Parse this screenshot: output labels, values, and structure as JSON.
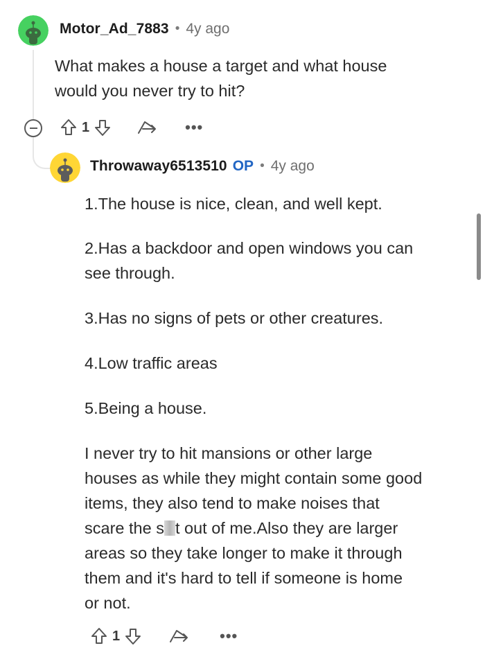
{
  "parent_comment": {
    "username": "Motor_Ad_7883",
    "separator": "•",
    "time": "4y ago",
    "text_lines": [
      "What makes a house a target and what house",
      "would you never try to hit?"
    ],
    "score": "1",
    "more_label": "•••",
    "avatar_color": "#46d160"
  },
  "reply_comment": {
    "username": "Throwaway6513510",
    "op_label": "OP",
    "separator": "•",
    "time": "4y ago",
    "paragraphs": [
      [
        "1.The house is nice, clean, and well kept."
      ],
      [
        "2.Has a backdoor and open windows you can",
        "see through."
      ],
      [
        "3.Has no signs of pets or other creatures."
      ],
      [
        "4.Low traffic areas"
      ],
      [
        "5.Being a house."
      ],
      [
        "I never try to hit mansions or other large",
        "houses as while they might contain some good",
        "items, they also tend to make noises that",
        "scare the s",
        "t out of me.Also they are larger",
        "areas so they take longer to make it through",
        "them and it's hard to tell if someone is home",
        "or not."
      ]
    ],
    "score": "1",
    "more_label": "•••",
    "avatar_color": "#ffd635",
    "op_color": "#2266c4"
  },
  "icons": {
    "upvote": "upvote-icon",
    "downvote": "downvote-icon",
    "share": "share-icon",
    "more": "more-icon",
    "collapse": "collapse-icon"
  }
}
